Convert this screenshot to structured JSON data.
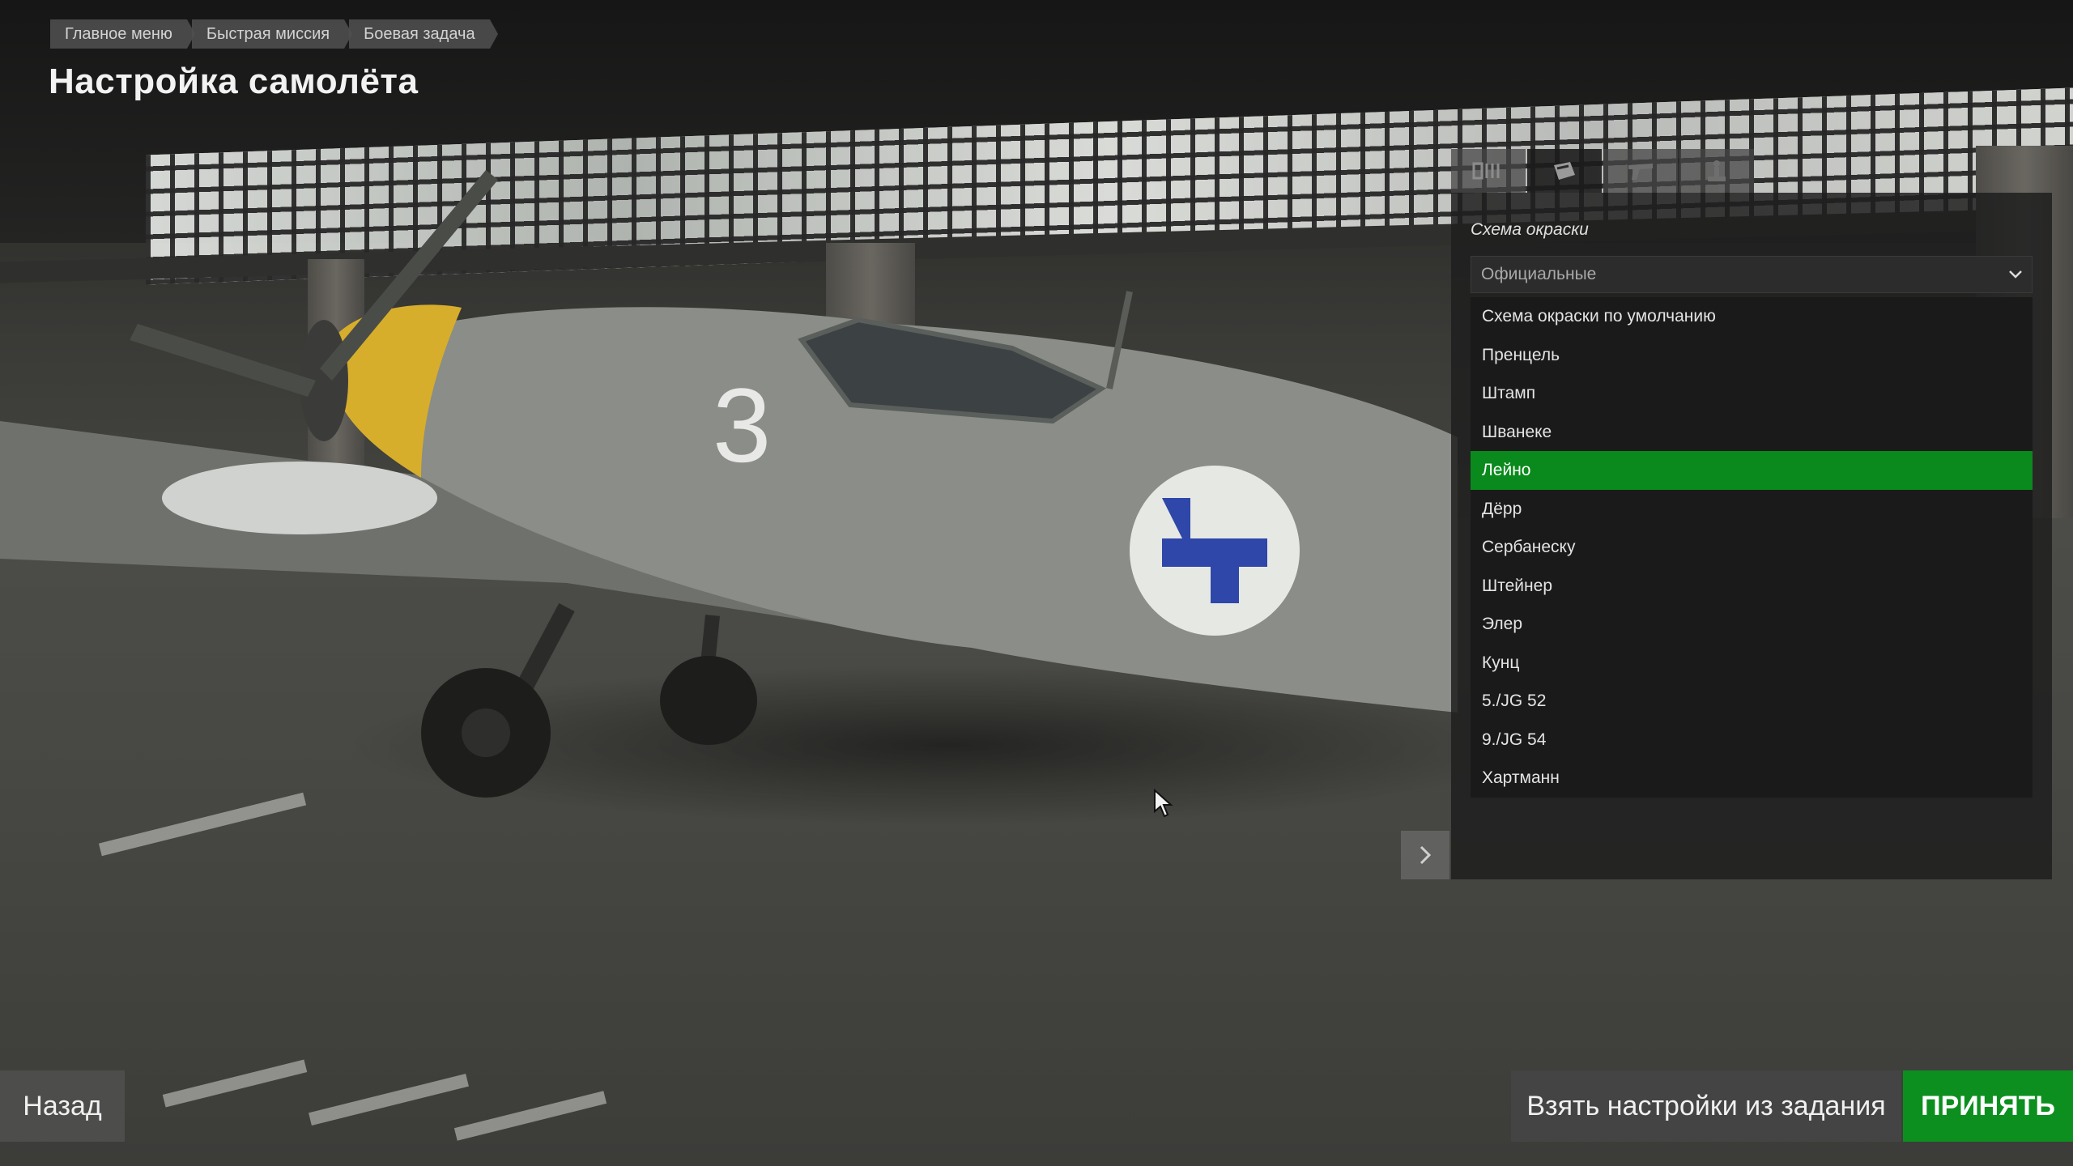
{
  "breadcrumb": [
    "Главное меню",
    "Быстрая миссия",
    "Боевая задача"
  ],
  "page_title": "Настройка самолёта",
  "tabs": [
    {
      "name": "loadout-icon",
      "active": false
    },
    {
      "name": "skin-icon",
      "active": true
    },
    {
      "name": "weapon-icon",
      "active": false
    },
    {
      "name": "pilot-icon",
      "active": false
    }
  ],
  "paint_scheme": {
    "label": "Схема окраски",
    "dropdown_value": "Официальные",
    "items": [
      "Схема окраски по умолчанию",
      "Пренцель",
      "Штамп",
      "Шванеке",
      "Лейно",
      "Дёрр",
      "Сербанеску",
      "Штейнер",
      "Элер",
      "Кунц",
      "5./JG 52",
      "9./JG 54",
      "Хартманн"
    ],
    "selected": "Лейно"
  },
  "buttons": {
    "back": "Назад",
    "take_from_mission": "Взять настройки из задания",
    "accept": "ПРИНЯТЬ"
  },
  "colors": {
    "accent": "#0a8a1c",
    "panel_bg": "#1e1e1e"
  }
}
